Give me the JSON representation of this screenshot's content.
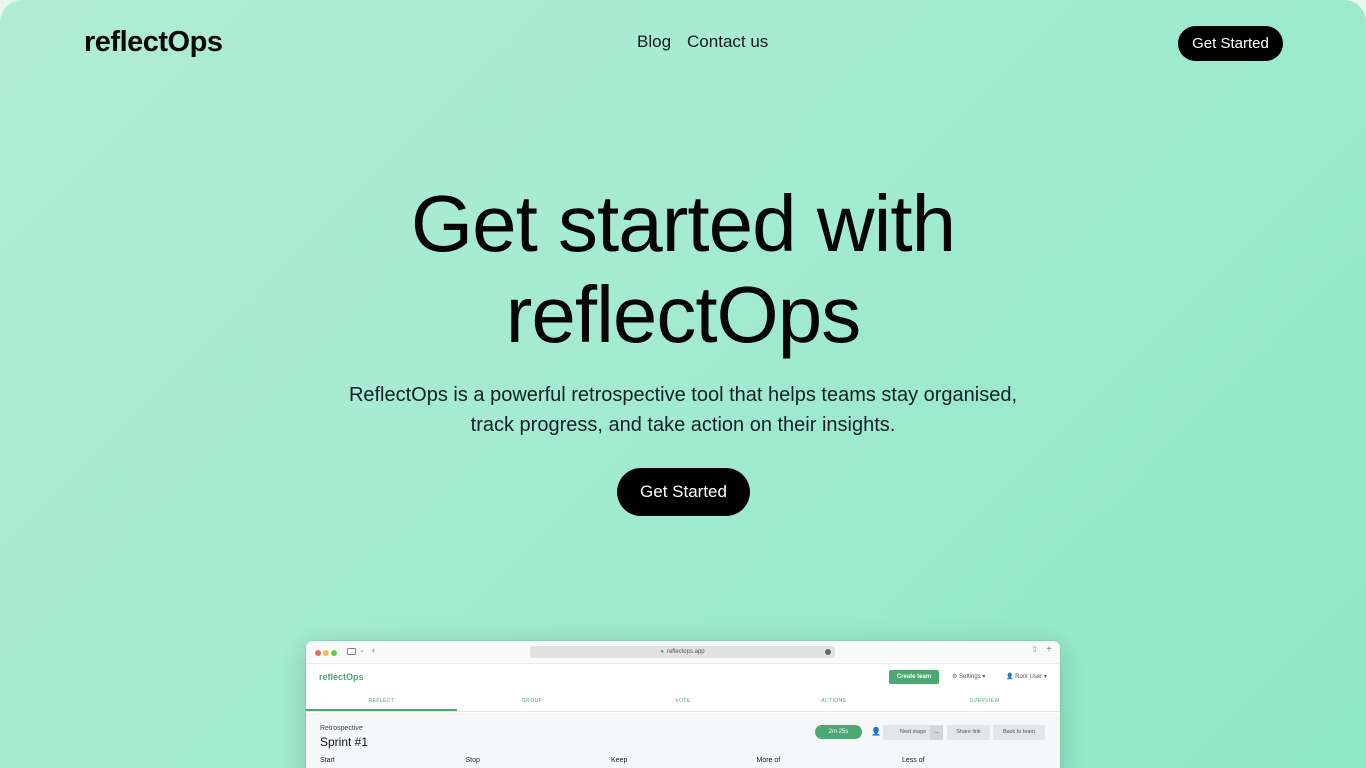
{
  "header": {
    "logo": "reflectOps",
    "nav": [
      "Blog",
      "Contact us"
    ],
    "cta": "Get Started"
  },
  "hero": {
    "title_lines": [
      "Get started with",
      "reflectOps"
    ],
    "subtitle_lines": [
      "ReflectOps is a powerful retrospective tool that helps teams stay organised,",
      "track progress, and take action on their insights."
    ],
    "cta": "Get Started"
  },
  "colors": {
    "accent": "#4aa870",
    "button_dark": "#000000",
    "background_gradient": [
      "#b1ecd5",
      "#8ee8c6"
    ]
  },
  "app_preview": {
    "url": "reflectops.app",
    "logo": "reflectOps",
    "create_team": "Create team",
    "settings": "Settings",
    "user": "Root User",
    "tabs": [
      "REFLECT",
      "GROUP",
      "VOTE",
      "ACTIONS",
      "OVERVIEW"
    ],
    "active_tab": "REFLECT",
    "retro_label": "Retrospective",
    "retro_title": "Sprint #1",
    "timer": "2m 25s",
    "next_stage": "Next stage",
    "share_link": "Share link",
    "back_to_team": "Back to team",
    "columns": [
      "Start",
      "Stop",
      "Keep",
      "More of",
      "Less of"
    ]
  }
}
